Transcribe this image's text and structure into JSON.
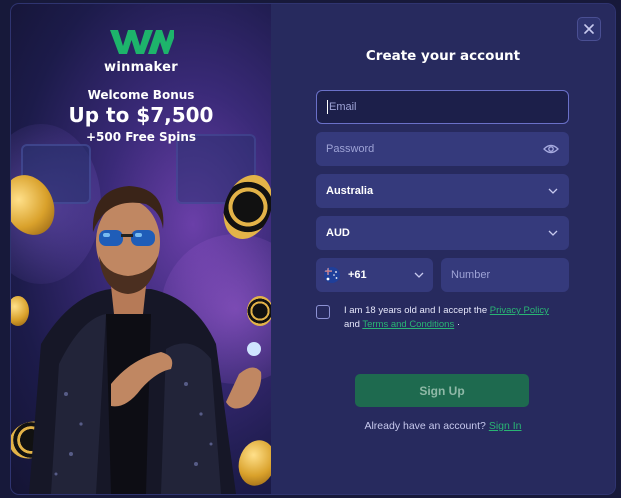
{
  "brand": {
    "logo_text": "winmaker",
    "accent": "#1db46b"
  },
  "promo": {
    "bonus_label": "Welcome Bonus",
    "bonus_amount": "Up to $7,500",
    "bonus_spins": "+500 Free Spins"
  },
  "form": {
    "title": "Create your account",
    "email": {
      "placeholder": "Email"
    },
    "password": {
      "placeholder": "Password"
    },
    "country": {
      "value": "Australia"
    },
    "currency": {
      "value": "AUD"
    },
    "phone": {
      "prefix": "+61",
      "placeholder": "Number"
    },
    "terms": {
      "text_before": "I am 18 years old and I accept the ",
      "privacy_link": "Privacy Policy",
      "text_and": "and ",
      "terms_link": "Terms and Conditions",
      "text_after": " ·"
    },
    "signup_label": "Sign Up",
    "signin_prompt": "Already have an account? ",
    "signin_link": "Sign In"
  },
  "icons": {
    "close": "close-icon",
    "eye": "eye-icon",
    "chevron": "chevron-down-icon",
    "flag": "australia-flag-icon"
  }
}
